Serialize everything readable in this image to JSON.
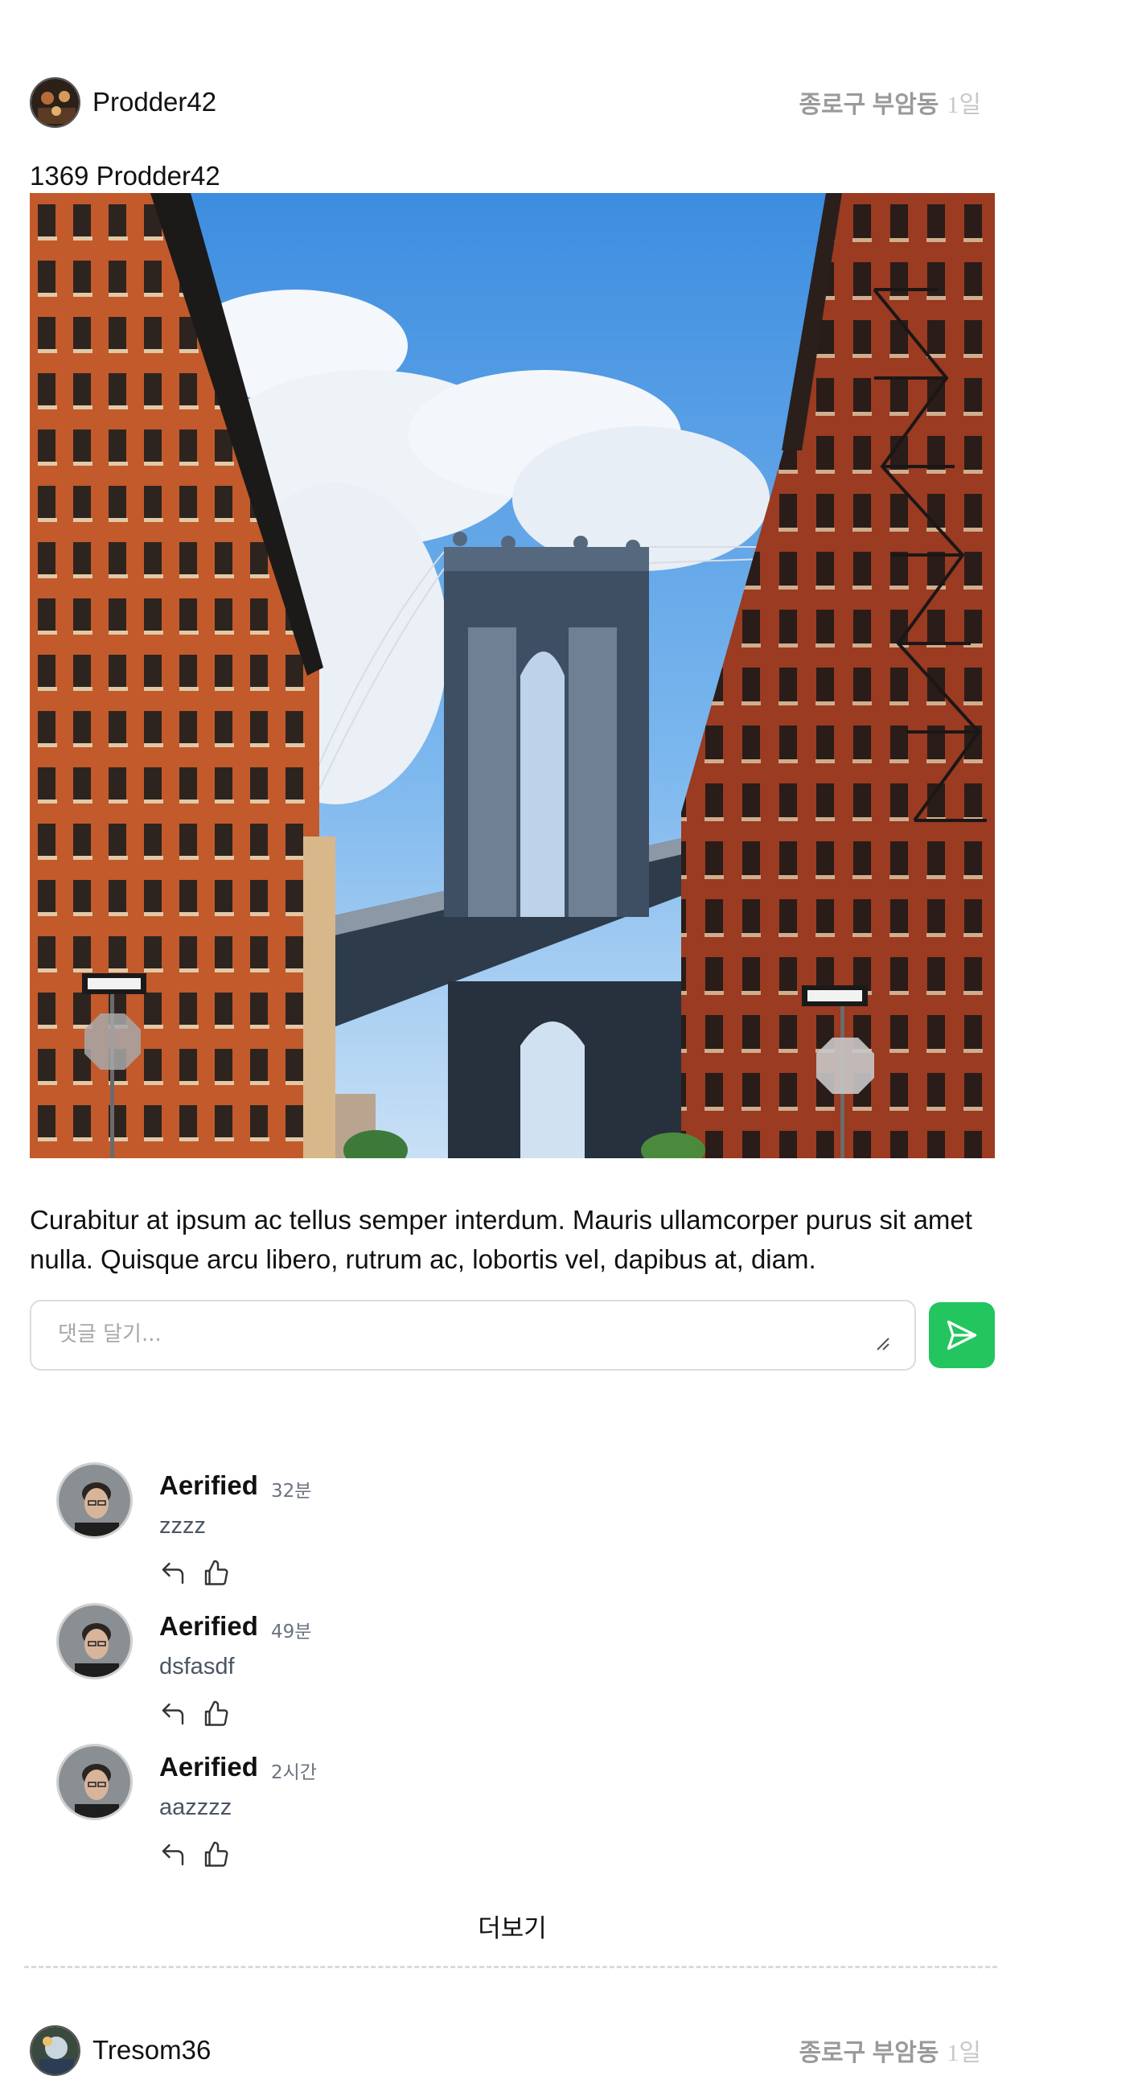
{
  "posts": [
    {
      "author": "Prodder42",
      "location": "종로구 부암동",
      "age": "1일",
      "title": "1369 Prodder42",
      "body": "Curabitur at ipsum ac tellus semper interdum. Mauris ullamcorper purus sit amet nulla. Quisque arcu libero, rutrum ac, lobortis vel, dapibus at, diam.",
      "comment_placeholder": "댓글 달기...",
      "comments": [
        {
          "author": "Aerified",
          "time": "32분",
          "text": "zzzz"
        },
        {
          "author": "Aerified",
          "time": "49분",
          "text": "dsfasdf"
        },
        {
          "author": "Aerified",
          "time": "2시간",
          "text": "aazzzz"
        }
      ],
      "more_label": "더보기"
    },
    {
      "author": "Tresom36",
      "location": "종로구 부암동",
      "age": "1일"
    }
  ],
  "icons": {
    "send": "send-icon",
    "reply": "reply-icon",
    "like": "thumbs-up-icon"
  },
  "colors": {
    "accent": "#22c55e",
    "location_text": "#9a9a9a",
    "muted_text": "#6b7280"
  }
}
